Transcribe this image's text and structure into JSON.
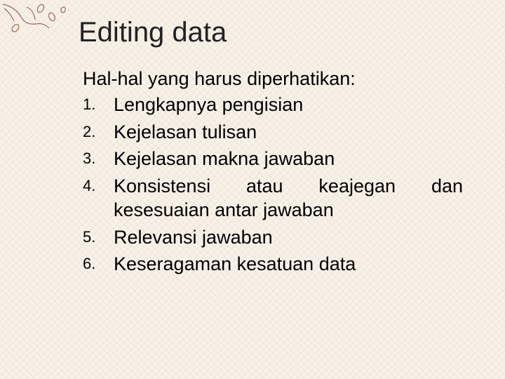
{
  "slide": {
    "title": "Editing data",
    "intro": "Hal-hal yang harus diperhatikan:",
    "items": [
      {
        "num": "1.",
        "text": "Lengkapnya pengisian"
      },
      {
        "num": "2.",
        "text": "Kejelasan tulisan"
      },
      {
        "num": "3.",
        "text": "Kejelasan makna jawaban"
      },
      {
        "num": "4.",
        "text": "Konsistensi atau keajegan dan kesesuaian antar jawaban"
      },
      {
        "num": "5.",
        "text": "Relevansi jawaban"
      },
      {
        "num": "6.",
        "text": "Keseragaman kesatuan data"
      }
    ]
  },
  "colors": {
    "background": "#f7f1e8",
    "accent": "#7a3f2f"
  }
}
